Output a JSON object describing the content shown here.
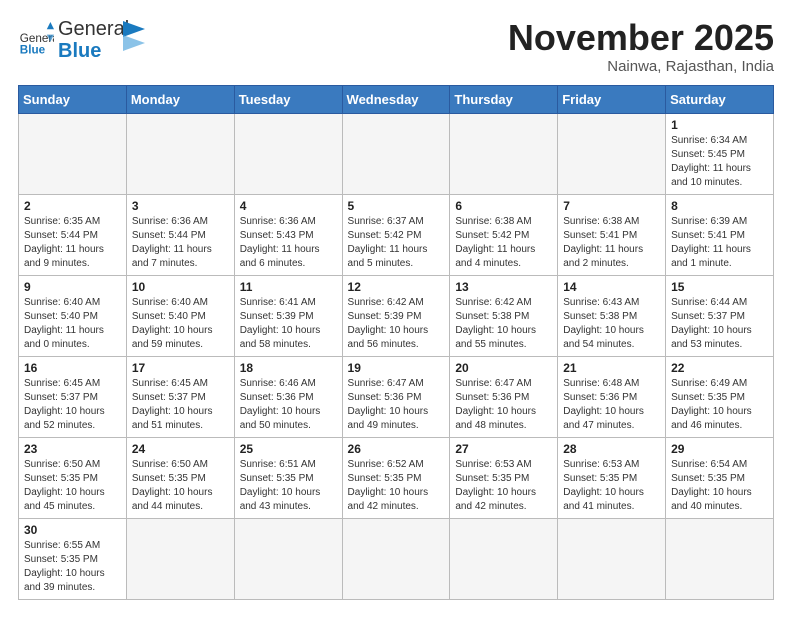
{
  "header": {
    "logo_text_regular": "General",
    "logo_text_blue": "Blue",
    "month_title": "November 2025",
    "subtitle": "Nainwa, Rajasthan, India"
  },
  "weekdays": [
    "Sunday",
    "Monday",
    "Tuesday",
    "Wednesday",
    "Thursday",
    "Friday",
    "Saturday"
  ],
  "weeks": [
    [
      {
        "day": "",
        "info": ""
      },
      {
        "day": "",
        "info": ""
      },
      {
        "day": "",
        "info": ""
      },
      {
        "day": "",
        "info": ""
      },
      {
        "day": "",
        "info": ""
      },
      {
        "day": "",
        "info": ""
      },
      {
        "day": "1",
        "info": "Sunrise: 6:34 AM\nSunset: 5:45 PM\nDaylight: 11 hours\nand 10 minutes."
      }
    ],
    [
      {
        "day": "2",
        "info": "Sunrise: 6:35 AM\nSunset: 5:44 PM\nDaylight: 11 hours\nand 9 minutes."
      },
      {
        "day": "3",
        "info": "Sunrise: 6:36 AM\nSunset: 5:44 PM\nDaylight: 11 hours\nand 7 minutes."
      },
      {
        "day": "4",
        "info": "Sunrise: 6:36 AM\nSunset: 5:43 PM\nDaylight: 11 hours\nand 6 minutes."
      },
      {
        "day": "5",
        "info": "Sunrise: 6:37 AM\nSunset: 5:42 PM\nDaylight: 11 hours\nand 5 minutes."
      },
      {
        "day": "6",
        "info": "Sunrise: 6:38 AM\nSunset: 5:42 PM\nDaylight: 11 hours\nand 4 minutes."
      },
      {
        "day": "7",
        "info": "Sunrise: 6:38 AM\nSunset: 5:41 PM\nDaylight: 11 hours\nand 2 minutes."
      },
      {
        "day": "8",
        "info": "Sunrise: 6:39 AM\nSunset: 5:41 PM\nDaylight: 11 hours\nand 1 minute."
      }
    ],
    [
      {
        "day": "9",
        "info": "Sunrise: 6:40 AM\nSunset: 5:40 PM\nDaylight: 11 hours\nand 0 minutes."
      },
      {
        "day": "10",
        "info": "Sunrise: 6:40 AM\nSunset: 5:40 PM\nDaylight: 10 hours\nand 59 minutes."
      },
      {
        "day": "11",
        "info": "Sunrise: 6:41 AM\nSunset: 5:39 PM\nDaylight: 10 hours\nand 58 minutes."
      },
      {
        "day": "12",
        "info": "Sunrise: 6:42 AM\nSunset: 5:39 PM\nDaylight: 10 hours\nand 56 minutes."
      },
      {
        "day": "13",
        "info": "Sunrise: 6:42 AM\nSunset: 5:38 PM\nDaylight: 10 hours\nand 55 minutes."
      },
      {
        "day": "14",
        "info": "Sunrise: 6:43 AM\nSunset: 5:38 PM\nDaylight: 10 hours\nand 54 minutes."
      },
      {
        "day": "15",
        "info": "Sunrise: 6:44 AM\nSunset: 5:37 PM\nDaylight: 10 hours\nand 53 minutes."
      }
    ],
    [
      {
        "day": "16",
        "info": "Sunrise: 6:45 AM\nSunset: 5:37 PM\nDaylight: 10 hours\nand 52 minutes."
      },
      {
        "day": "17",
        "info": "Sunrise: 6:45 AM\nSunset: 5:37 PM\nDaylight: 10 hours\nand 51 minutes."
      },
      {
        "day": "18",
        "info": "Sunrise: 6:46 AM\nSunset: 5:36 PM\nDaylight: 10 hours\nand 50 minutes."
      },
      {
        "day": "19",
        "info": "Sunrise: 6:47 AM\nSunset: 5:36 PM\nDaylight: 10 hours\nand 49 minutes."
      },
      {
        "day": "20",
        "info": "Sunrise: 6:47 AM\nSunset: 5:36 PM\nDaylight: 10 hours\nand 48 minutes."
      },
      {
        "day": "21",
        "info": "Sunrise: 6:48 AM\nSunset: 5:36 PM\nDaylight: 10 hours\nand 47 minutes."
      },
      {
        "day": "22",
        "info": "Sunrise: 6:49 AM\nSunset: 5:35 PM\nDaylight: 10 hours\nand 46 minutes."
      }
    ],
    [
      {
        "day": "23",
        "info": "Sunrise: 6:50 AM\nSunset: 5:35 PM\nDaylight: 10 hours\nand 45 minutes."
      },
      {
        "day": "24",
        "info": "Sunrise: 6:50 AM\nSunset: 5:35 PM\nDaylight: 10 hours\nand 44 minutes."
      },
      {
        "day": "25",
        "info": "Sunrise: 6:51 AM\nSunset: 5:35 PM\nDaylight: 10 hours\nand 43 minutes."
      },
      {
        "day": "26",
        "info": "Sunrise: 6:52 AM\nSunset: 5:35 PM\nDaylight: 10 hours\nand 42 minutes."
      },
      {
        "day": "27",
        "info": "Sunrise: 6:53 AM\nSunset: 5:35 PM\nDaylight: 10 hours\nand 42 minutes."
      },
      {
        "day": "28",
        "info": "Sunrise: 6:53 AM\nSunset: 5:35 PM\nDaylight: 10 hours\nand 41 minutes."
      },
      {
        "day": "29",
        "info": "Sunrise: 6:54 AM\nSunset: 5:35 PM\nDaylight: 10 hours\nand 40 minutes."
      }
    ],
    [
      {
        "day": "30",
        "info": "Sunrise: 6:55 AM\nSunset: 5:35 PM\nDaylight: 10 hours\nand 39 minutes."
      },
      {
        "day": "",
        "info": ""
      },
      {
        "day": "",
        "info": ""
      },
      {
        "day": "",
        "info": ""
      },
      {
        "day": "",
        "info": ""
      },
      {
        "day": "",
        "info": ""
      },
      {
        "day": "",
        "info": ""
      }
    ]
  ]
}
